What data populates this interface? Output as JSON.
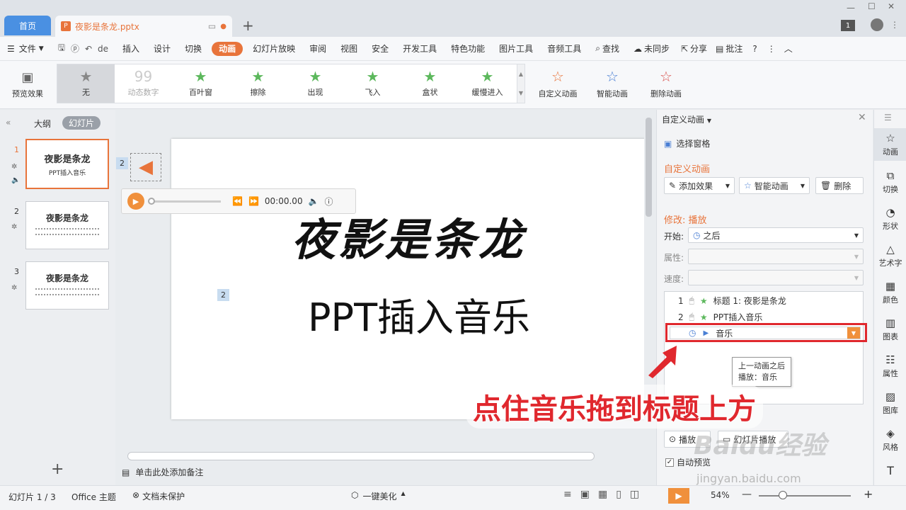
{
  "tabs": {
    "home": "首页",
    "doc": "夜影是条龙.pptx",
    "badge": "1"
  },
  "menu": {
    "file": "文件",
    "items": [
      "插入",
      "设计",
      "切换",
      "动画",
      "幻灯片放映",
      "审阅",
      "视图",
      "安全",
      "开发工具",
      "特色功能",
      "图片工具",
      "音频工具"
    ],
    "search": "查找",
    "sync": "未同步",
    "share": "分享",
    "comment": "批注",
    "help": "?",
    "partial": "de"
  },
  "ribbon": {
    "preview": "预览效果",
    "gallery": [
      "无",
      "动态数字",
      "百叶窗",
      "擦除",
      "出现",
      "飞入",
      "盒状",
      "缓慢进入"
    ],
    "custom": "自定义动画",
    "smart": "智能动画",
    "delete": "删除动画"
  },
  "leftpane": {
    "outline": "大纲",
    "slides": "幻灯片",
    "nums": [
      "1",
      "2",
      "3"
    ],
    "t1_title": "夜影是条龙",
    "t1_sub": "PPT插入音乐",
    "t2_title": "夜影是条龙",
    "t3_title": "夜影是条龙",
    "add": "+"
  },
  "slide": {
    "title": "夜影是条龙",
    "subtitle": "PPT插入音乐",
    "tag_audio": "2",
    "tag_sub": "2",
    "time": "00:00.00"
  },
  "notes": "单击此处添加备注",
  "rightpane": {
    "header": "自定义动画",
    "select_pane": "选择窗格",
    "section": "自定义动画",
    "add_effect": "添加效果",
    "smart": "智能动画",
    "delete": "删除",
    "modify": "修改: 播放",
    "start_label": "开始:",
    "start_value": "之后",
    "prop_label": "属性:",
    "speed_label": "速度:",
    "list": [
      {
        "num": "1",
        "text": "标题 1: 夜影是条龙"
      },
      {
        "num": "2",
        "text": "PPT插入音乐"
      },
      {
        "num": "",
        "text": "音乐"
      }
    ],
    "tooltip1": "上一动画之后",
    "tooltip2": "播放：音乐",
    "play": "播放",
    "slideshow": "幻灯片播放",
    "autopreview": "自动预览"
  },
  "sidebar": [
    "动画",
    "切换",
    "形状",
    "艺术字",
    "颜色",
    "图表",
    "属性",
    "图库",
    "风格"
  ],
  "annotation": "点住音乐拖到标题上方",
  "watermark": {
    "brand": "Baidu经验",
    "url": "jingyan.baidu.com"
  },
  "status": {
    "slide": "幻灯片 1 / 3",
    "theme": "Office 主题",
    "protect": "文档未保护",
    "beautify": "一键美化",
    "zoom": "54%"
  }
}
